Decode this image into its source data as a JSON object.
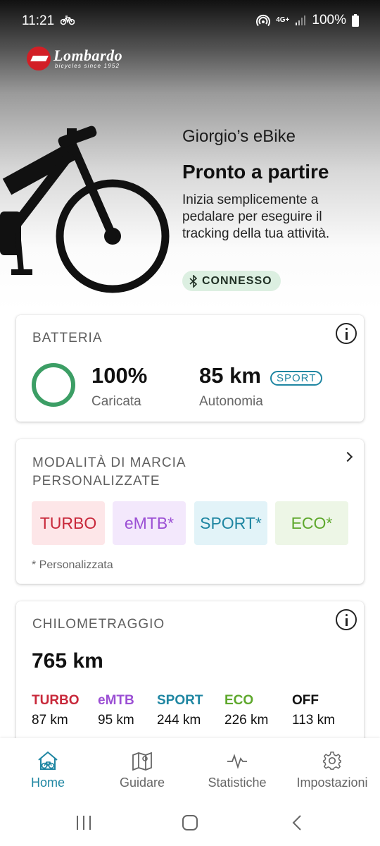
{
  "status_bar": {
    "time": "11:21",
    "network": "4G+",
    "battery": "100%"
  },
  "brand": {
    "name": "Lombardo",
    "tagline": "bicycles since 1952"
  },
  "hero": {
    "bike_name": "Giorgio’s eBike",
    "status_title": "Pronto a partire",
    "description": "Inizia semplicemente a pedalare per eseguire il tracking della tua attività.",
    "connection_label": "CONNESSO"
  },
  "battery_card": {
    "title": "BATTERIA",
    "charge_value": "100%",
    "charge_label": "Caricata",
    "charge_fraction": 1.0,
    "range_value": "85 km",
    "range_label": "Autonomia",
    "range_mode": "SPORT"
  },
  "modes_card": {
    "title_line1": "MODALITÀ DI MARCIA",
    "title_line2": "PERSONALIZZATE",
    "modes": [
      {
        "label": "TURBO",
        "color": "#c8283a",
        "bg": "#fde6e8"
      },
      {
        "label": "eMTB*",
        "color": "#9b4fd4",
        "bg": "#f3e8fc"
      },
      {
        "label": "SPORT*",
        "color": "#1f86a2",
        "bg": "#e2f3f8"
      },
      {
        "label": "ECO*",
        "color": "#5ea82c",
        "bg": "#edf6e6"
      }
    ],
    "footnote": "* Personalizzata"
  },
  "mileage_card": {
    "title": "CHILOMETRAGGIO",
    "total": "765 km",
    "modes": [
      {
        "label": "TURBO",
        "value": "87 km",
        "color": "#c8283a"
      },
      {
        "label": "eMTB",
        "value": "95 km",
        "color": "#9b4fd4"
      },
      {
        "label": "SPORT",
        "value": "244 km",
        "color": "#1f86a2"
      },
      {
        "label": "ECO",
        "value": "226 km",
        "color": "#5ea82c"
      },
      {
        "label": "OFF",
        "value": "113 km",
        "color": "#111111"
      }
    ]
  },
  "bottom_nav": {
    "items": [
      {
        "label": "Home",
        "icon": "home-bike-icon",
        "active": true
      },
      {
        "label": "Guidare",
        "icon": "map-icon",
        "active": false
      },
      {
        "label": "Statistiche",
        "icon": "activity-icon",
        "active": false
      },
      {
        "label": "Impostazioni",
        "icon": "gear-icon",
        "active": false
      }
    ]
  },
  "accent_color": "#1f86a2"
}
